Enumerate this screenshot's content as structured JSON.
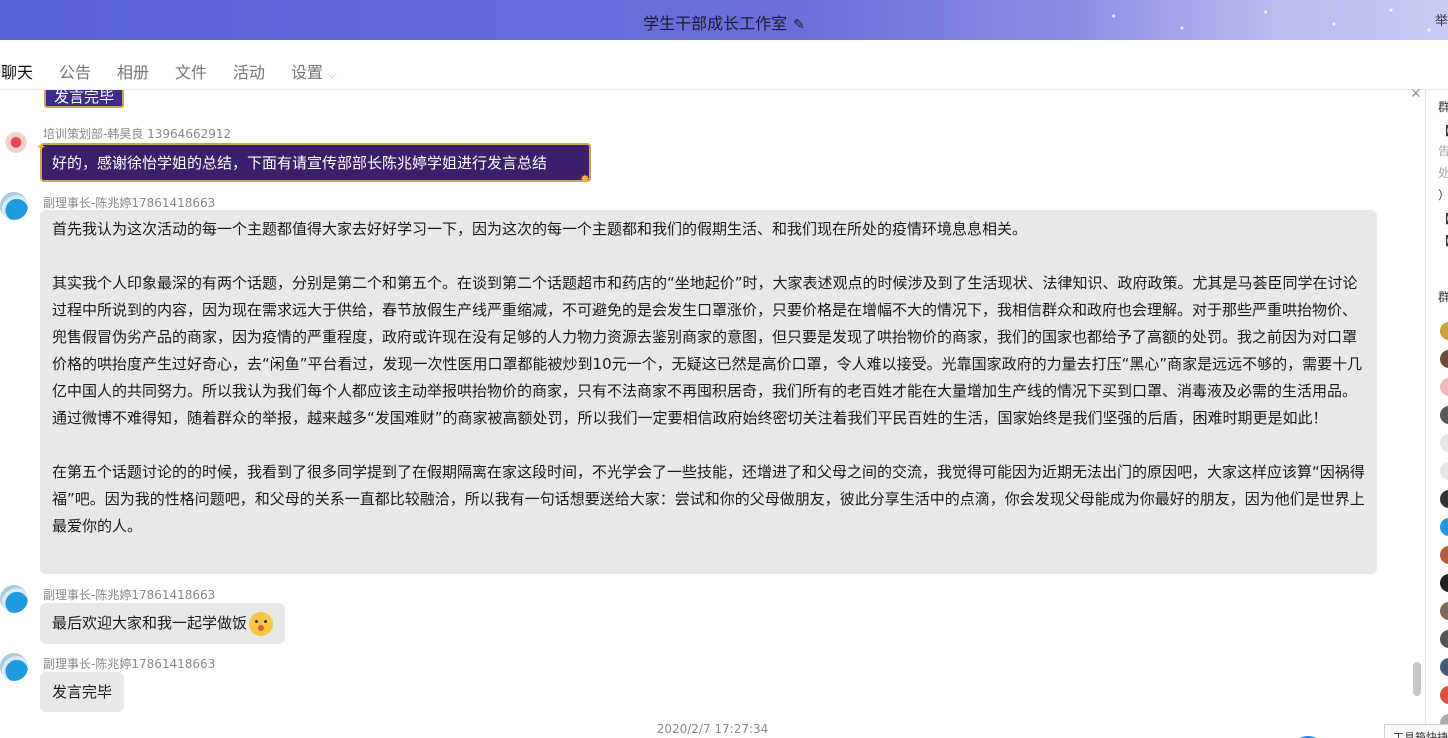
{
  "window": {
    "title": "学生干部成长工作室",
    "edit_icon": "pencil-icon",
    "right_cut_text": "举"
  },
  "tabs": [
    {
      "label": "聊天",
      "active": true
    },
    {
      "label": "公告"
    },
    {
      "label": "相册"
    },
    {
      "label": "文件"
    },
    {
      "label": "活动"
    },
    {
      "label": "设置"
    }
  ],
  "messages": {
    "top_partial_text": "发言完毕",
    "m1": {
      "sender": "培训策划部-韩昊良 13964662912",
      "text": "好的，感谢徐怡学姐的总结，下面有请宣传部部长陈兆婷学姐进行发言总结"
    },
    "m2": {
      "sender": "副理事长-陈兆婷17861418663",
      "paragraphs": [
        "首先我认为这次活动的每一个主题都值得大家去好好学习一下，因为这次的每一个主题都和我们的假期生活、和我们现在所处的疫情环境息息相关。",
        "其实我个人印象最深的有两个话题，分别是第二个和第五个。在谈到第二个话题超市和药店的“坐地起价”时，大家表述观点的时候涉及到了生活现状、法律知识、政府政策。尤其是马荟臣同学在讨论过程中所说到的内容，因为现在需求远大于供给，春节放假生产线严重缩减，不可避免的是会发生口罩涨价，只要价格是在增幅不大的情况下，我相信群众和政府也会理解。对于那些严重哄抬物价、兜售假冒伪劣产品的商家，因为疫情的严重程度，政府或许现在没有足够的人力物力资源去鉴别商家的意图，但只要是发现了哄抬物价的商家，我们的国家也都给予了高额的处罚。我之前因为对口罩价格的哄抬度产生过好奇心，去“闲鱼”平台看过，发现一次性医用口罩都能被炒到10元一个，无疑这已然是高价口罩，令人难以接受。光靠国家政府的力量去打压“黑心”商家是远远不够的，需要十几亿中国人的共同努力。所以我认为我们每个人都应该主动举报哄抬物价的商家，只有不法商家不再囤积居奇，我们所有的老百姓才能在大量增加生产线的情况下买到口罩、消毒液及必需的生活用品。通过微博不难得知，随着群众的举报，越来越多“发国难财”的商家被高额处罚，所以我们一定要相信政府始终密切关注着我们平民百姓的生活，国家始终是我们坚强的后盾，困难时期更是如此！",
        "在第五个话题讨论的的时候，我看到了很多同学提到了在假期隔离在家这段时间，不光学会了一些技能，还增进了和父母之间的交流，我觉得可能因为近期无法出门的原因吧，大家这样应该算“因祸得福”吧。因为我的性格问题吧，和父母的关系一直都比较融洽，所以我有一句话想要送给大家：尝试和你的父母做朋友，彼此分享生活中的点滴，你会发现父母能成为你最好的朋友，因为他们是世界上最爱你的人。"
      ]
    },
    "m3": {
      "sender": "副理事长-陈兆婷17861418663",
      "text": "最后欢迎大家和我一起学做饭",
      "emoji": "surprised-face-icon"
    },
    "m4": {
      "sender": "副理事长-陈兆婷17861418663",
      "text": "发言完毕"
    },
    "timestamp": "2020/2/7 17:27:34"
  },
  "right_panel": {
    "header1": "群",
    "lines": [
      "【",
      "告",
      "处",
      "）",
      "【",
      "【"
    ],
    "header2": "群"
  },
  "toolbox_label": "工具箱快捷"
}
